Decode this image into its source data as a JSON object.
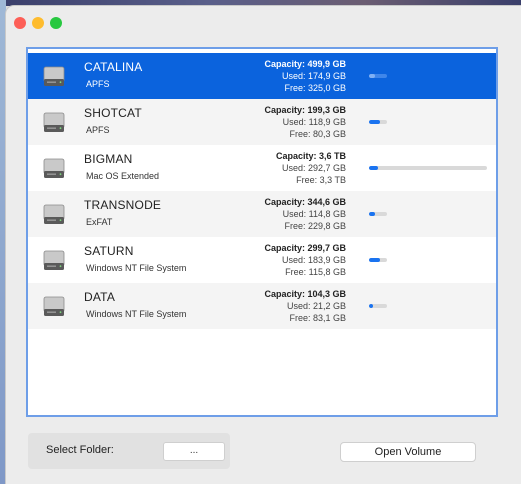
{
  "window": {
    "controls": [
      "close",
      "minimize",
      "zoom"
    ]
  },
  "volumes": [
    {
      "name": "CATALINA",
      "fs": "APFS",
      "capacity": "Capacity: 499,9 GB",
      "used": "Used: 174,9 GB",
      "free": "Free: 325,0 GB",
      "used_fraction": 0.35,
      "selected": true
    },
    {
      "name": "SHOTCAT",
      "fs": "APFS",
      "capacity": "Capacity: 199,3 GB",
      "used": "Used: 118,9 GB",
      "free": "Free: 80,3 GB",
      "used_fraction": 0.6,
      "selected": false
    },
    {
      "name": "BIGMAN",
      "fs": "Mac OS Extended",
      "capacity": "Capacity: 3,6 TB",
      "used": "Used: 292,7 GB",
      "free": "Free: 3,3 TB",
      "used_fraction": 0.08,
      "selected": false
    },
    {
      "name": "TRANSNODE",
      "fs": "ExFAT",
      "capacity": "Capacity: 344,6 GB",
      "used": "Used: 114,8 GB",
      "free": "Free: 229,8 GB",
      "used_fraction": 0.33,
      "selected": false
    },
    {
      "name": "SATURN",
      "fs": "Windows NT File System",
      "capacity": "Capacity: 299,7 GB",
      "used": "Used: 183,9 GB",
      "free": "Free: 115,8 GB",
      "used_fraction": 0.61,
      "selected": false
    },
    {
      "name": "DATA",
      "fs": "Windows NT File System",
      "capacity": "Capacity: 104,3 GB",
      "used": "Used: 21,2 GB",
      "free": "Free: 83,1 GB",
      "used_fraction": 0.2,
      "selected": false
    }
  ],
  "footer": {
    "select_folder_label": "Select Folder:",
    "folder_button_label": "...",
    "open_volume_label": "Open Volume"
  },
  "colors": {
    "selection": "#0b63dd",
    "bar_fill": "#1a73f0",
    "list_border": "#6e9ee8"
  }
}
